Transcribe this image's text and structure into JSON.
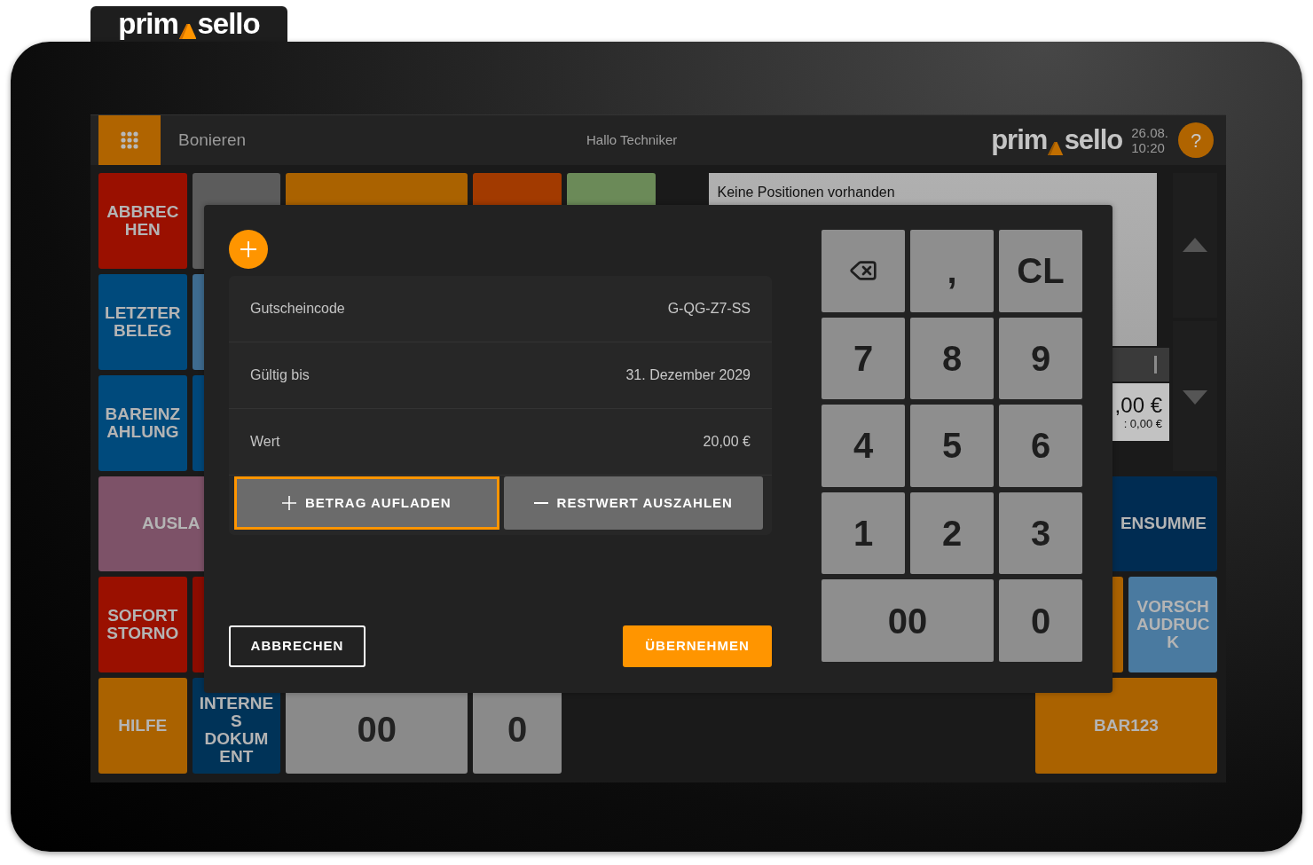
{
  "device": {
    "tab_logo": {
      "left": "prim",
      "right": "sello"
    }
  },
  "header": {
    "title": "Bonieren",
    "greeting": "Hallo Techniker",
    "logo": {
      "left": "prim",
      "right": "sello"
    },
    "date": "26.08.",
    "time": "10:20",
    "help_label": "?"
  },
  "tiles": [
    {
      "kind": "function",
      "lines": [
        "ABBREC",
        "HEN"
      ],
      "color": "#9a1000"
    },
    {
      "kind": "function",
      "color": "#5c5c5c"
    },
    {
      "kind": "function",
      "color": "#aa6200"
    },
    {
      "kind": "function",
      "color": "#a23a00"
    },
    {
      "kind": "function",
      "color": "#6b8a58"
    },
    {
      "kind": "function",
      "lines": [
        "LETZTER",
        "BELEG"
      ],
      "color": "#004a7c"
    },
    {
      "kind": "function",
      "color": "#3e6b8f"
    },
    {
      "kind": "function",
      "lines": [
        "BAREINZ",
        "AHLUNG"
      ],
      "color": "#004a7c"
    },
    {
      "kind": "function",
      "color": "#00477a"
    },
    {
      "kind": "function",
      "lines": [
        "AUSLA"
      ],
      "color": "#7d5268"
    },
    {
      "kind": "function",
      "lines": [
        "ENSUMME"
      ],
      "color": "#002c52"
    },
    {
      "kind": "function",
      "lines": [
        "SOFORT",
        "STORNO"
      ],
      "color": "#9a1000"
    },
    {
      "kind": "function",
      "color": "#8c0c00"
    },
    {
      "kind": "function",
      "color": "#aa6200"
    },
    {
      "kind": "function",
      "lines": [
        "VORSCH",
        "AUDRUC",
        "K"
      ],
      "color": "#4a7aa0"
    },
    {
      "kind": "function",
      "lines": [
        "HILFE"
      ],
      "color": "#aa6200"
    },
    {
      "kind": "function",
      "lines": [
        "INTERNE",
        "S",
        "DOKUM",
        "ENT"
      ],
      "color": "#003358"
    },
    {
      "kind": "number",
      "lines": [
        "00"
      ],
      "color": "#8a8a8a"
    },
    {
      "kind": "number",
      "lines": [
        "0"
      ],
      "color": "#8a8a8a"
    },
    {
      "kind": "function",
      "lines": [
        "BAR123"
      ],
      "color": "#aa6200"
    }
  ],
  "receipt": {
    "empty_text": "Keine Positionen vorhanden",
    "total": ",00 €",
    "subtotal": ": 0,00 €"
  },
  "dialog": {
    "fields": [
      {
        "label": "Gutscheincode",
        "value": "G-QG-Z7-SS"
      },
      {
        "label": "Gültig bis",
        "value": "31. Dezember 2029"
      },
      {
        "label": "Wert",
        "value": "20,00 €"
      }
    ],
    "actions": [
      {
        "kind": "plus",
        "label": "BETRAG AUFLADEN",
        "focused": true
      },
      {
        "kind": "minus",
        "label": "RESTWERT AUSZAHLEN",
        "focused": false
      }
    ],
    "cancel": "ABBRECHEN",
    "confirm": "ÜBERNEHMEN",
    "keypad": [
      {
        "kind": "backspace"
      },
      {
        "kind": "key",
        "label": ","
      },
      {
        "kind": "key",
        "label": "CL"
      },
      {
        "kind": "key",
        "label": "7"
      },
      {
        "kind": "key",
        "label": "8"
      },
      {
        "kind": "key",
        "label": "9"
      },
      {
        "kind": "key",
        "label": "4"
      },
      {
        "kind": "key",
        "label": "5"
      },
      {
        "kind": "key",
        "label": "6"
      },
      {
        "kind": "key",
        "label": "1"
      },
      {
        "kind": "key",
        "label": "2"
      },
      {
        "kind": "key",
        "label": "3"
      },
      {
        "kind": "wide",
        "label": "00"
      },
      {
        "kind": "key",
        "label": "0"
      }
    ]
  }
}
